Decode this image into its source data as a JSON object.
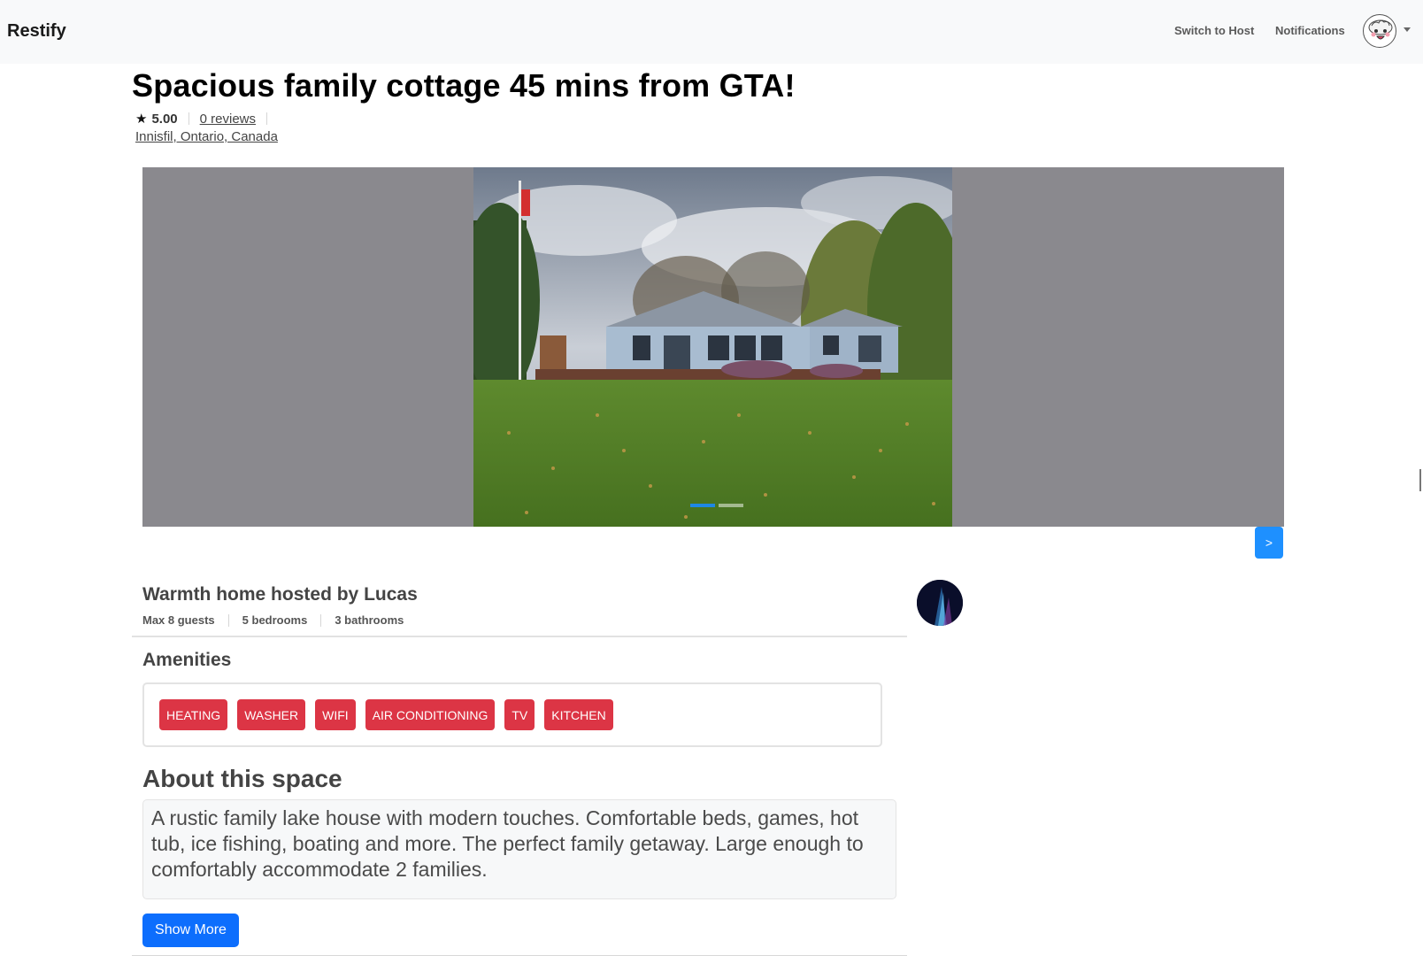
{
  "navbar": {
    "brand": "Restify",
    "switch_label": "Switch to Host",
    "notifications_label": "Notifications",
    "profile_icon": "avatar-icon"
  },
  "listing": {
    "title": "Spacious family cottage 45 mins from GTA!",
    "rating": "5.00",
    "reviews": "0 reviews",
    "location": "Innisfil, Ontario, Canada"
  },
  "carousel": {
    "next_label": ">",
    "slide_count": 2,
    "active_slide": 1
  },
  "host": {
    "title": "Warmth home hosted by Lucas",
    "guests": "Max 8 guests",
    "bedrooms": "5 bedrooms",
    "bathrooms": "3 bathrooms"
  },
  "amenities": {
    "title": "Amenities",
    "items": [
      "HEATING",
      "WASHER",
      "WIFI",
      "AIR CONDITIONING",
      "TV",
      "KITCHEN"
    ]
  },
  "about": {
    "title": "About this space",
    "text": "A rustic family lake house with modern touches. Comfortable beds, games, hot tub, ice fishing, boating and more. The perfect family getaway. Large enough to comfortably accommodate 2 families.",
    "show_more_label": "Show More"
  },
  "colors": {
    "accent": "#0d6efd",
    "amenity_chip": "#dc3545",
    "carousel_bg": "#8a898e",
    "navbar_bg": "#f8f9fa"
  }
}
